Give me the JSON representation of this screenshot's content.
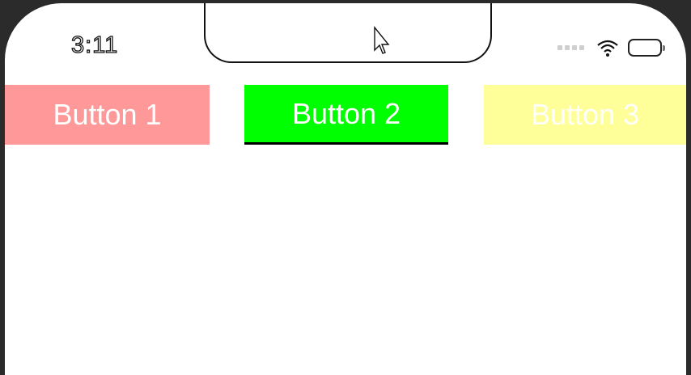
{
  "status_bar": {
    "time": "3:11",
    "icons": [
      "signal-dots-icon",
      "wifi-icon",
      "battery-icon"
    ]
  },
  "buttons": [
    {
      "label": "Button 1",
      "color": "#ff9999"
    },
    {
      "label": "Button 2",
      "color": "#00ff00"
    },
    {
      "label": "Button 3",
      "color": "#ffff99"
    }
  ],
  "colors": {
    "screen_background": "#ffffff",
    "bezel": "#2b2b2b"
  }
}
